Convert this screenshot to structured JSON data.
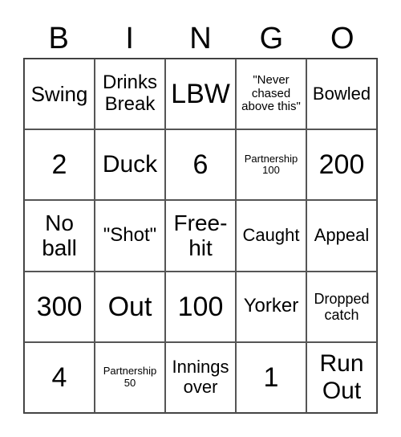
{
  "header": [
    "B",
    "I",
    "N",
    "G",
    "O"
  ],
  "cells": [
    [
      "Swing",
      "Drinks Break",
      "LBW",
      "\"Never chased above this\"",
      "Bowled"
    ],
    [
      "2",
      "Duck",
      "6",
      "Partnership 100",
      "200"
    ],
    [
      "No ball",
      "\"Shot\"",
      "Free-hit",
      "Caught",
      "Appeal"
    ],
    [
      "300",
      "Out",
      "100",
      "Yorker",
      "Dropped catch"
    ],
    [
      "4",
      "Partnership 50",
      "Innings over",
      "1",
      "Run Out"
    ]
  ]
}
